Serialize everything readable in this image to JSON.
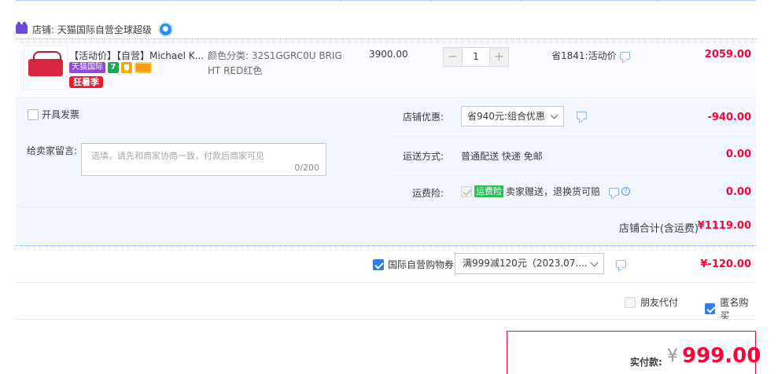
{
  "shop": {
    "label": "店铺: 天猫国际自营全球超级"
  },
  "item": {
    "title": "【活动价】【自营】Michael K...",
    "tags": {
      "tmall_intl": "天猫国际",
      "seven": "7",
      "kuangshu": "狂暑季"
    },
    "sku": "颜色分类: 32S1GGRC0U BRIGHT RED红色",
    "unit_price": "3900.00",
    "qty": {
      "minus": "−",
      "value": "1",
      "plus": "+"
    },
    "saving": "省1841:活动价",
    "total": "2059.00"
  },
  "invoice": {
    "label": "开具发票",
    "checked": false
  },
  "memo": {
    "label": "给卖家留言:",
    "placeholder": "选填，请先和商家协商一致，付款后商家可见",
    "counter": "0/200"
  },
  "shop_discount": {
    "label": "店铺优惠:",
    "selected": "省940元:组合优惠",
    "amount": "-940.00"
  },
  "shipping": {
    "label": "运送方式:",
    "value": "普通配送 快递 免邮",
    "amount": "0.00"
  },
  "freight_insurance": {
    "label": "运费险:",
    "badge": "运费险",
    "text": "卖家赠送，退换货可赔",
    "amount": "0.00"
  },
  "subtotal": {
    "label": "店铺合计(含运费)",
    "amount": "¥1119.00"
  },
  "coupon": {
    "label": "国际自营购物券",
    "selected": "满999减120元（2023.07....",
    "amount": "¥-120.00"
  },
  "friend_pay": {
    "label": "朋友代付"
  },
  "anonymous": {
    "label": "匿名购买"
  },
  "payment": {
    "label": "实付款:",
    "currency": "¥",
    "amount": "999.00"
  },
  "colors": {
    "accent_red": "#ff0036",
    "accent_blue": "#2d7df6",
    "panel_bg": "#f2f7ff"
  }
}
